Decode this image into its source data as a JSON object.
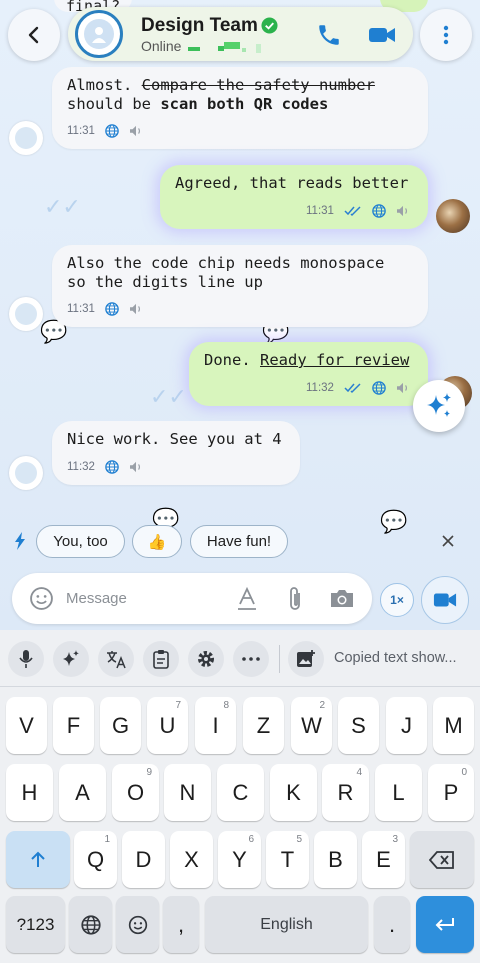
{
  "header": {
    "title": "Design Team",
    "status": "Online",
    "prev_fragment": "final?"
  },
  "messages": [
    {
      "id": "m1",
      "direction": "in",
      "text_plain": "Almost. ",
      "text_strike": "Compare the safety number",
      "line2_plain": "should be ",
      "line2_bold": "scan both QR codes",
      "time": "11:31"
    },
    {
      "id": "m2",
      "direction": "out",
      "text": "Agreed, that reads better",
      "time": "11:31"
    },
    {
      "id": "m3",
      "direction": "in",
      "line1": "Also the code chip needs monospace",
      "line2": "so the digits line up",
      "time": "11:31"
    },
    {
      "id": "m4",
      "direction": "out",
      "text_plain": "Done. ",
      "text_link": "Ready for review",
      "time": "11:32"
    },
    {
      "id": "m5",
      "direction": "in",
      "text": "Nice work. See you at 4",
      "time": "11:32"
    }
  ],
  "suggestions": [
    "You, too",
    "👍",
    "Have fun!"
  ],
  "composer": {
    "placeholder": "Message",
    "speed": "1×"
  },
  "keyboard": {
    "toolbar_clipboard_text": "Copied text show...",
    "row1": [
      {
        "k": "V"
      },
      {
        "k": "F"
      },
      {
        "k": "G"
      },
      {
        "k": "U",
        "h": "7"
      },
      {
        "k": "I",
        "h": "8"
      },
      {
        "k": "Z"
      },
      {
        "k": "W",
        "h": "2"
      },
      {
        "k": "S"
      },
      {
        "k": "J"
      },
      {
        "k": "M"
      }
    ],
    "row2": [
      {
        "k": "H"
      },
      {
        "k": "A"
      },
      {
        "k": "O",
        "h": "9"
      },
      {
        "k": "N"
      },
      {
        "k": "C"
      },
      {
        "k": "K"
      },
      {
        "k": "R",
        "h": "4"
      },
      {
        "k": "L"
      },
      {
        "k": "P",
        "h": "0"
      }
    ],
    "row3": [
      {
        "k": "Q",
        "h": "1"
      },
      {
        "k": "D"
      },
      {
        "k": "X"
      },
      {
        "k": "Y",
        "h": "6"
      },
      {
        "k": "T",
        "h": "5"
      },
      {
        "k": "B"
      },
      {
        "k": "E",
        "h": "3"
      }
    ],
    "sym_label": "?123",
    "comma": ",",
    "space_label": "English",
    "period": "."
  },
  "colors": {
    "accent": "#2e8fdc",
    "outgoing_bubble": "#d8f5bd",
    "incoming_bubble": "#f5f6f9",
    "verified": "#2bb24c"
  }
}
